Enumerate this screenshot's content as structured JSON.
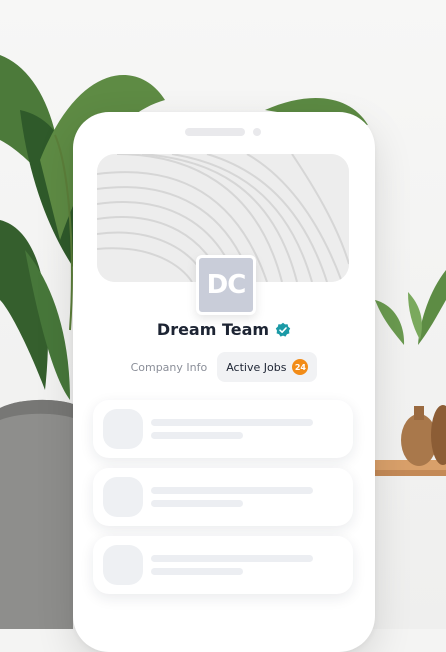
{
  "company": {
    "logo_initials": "DC",
    "name": "Dream Team",
    "verified_icon": "verified-badge-icon"
  },
  "tabs": [
    {
      "label": "Company Info",
      "active": false
    },
    {
      "label": "Active Jobs",
      "active": true,
      "badge": "24"
    }
  ],
  "placeholder_cards": 3,
  "colors": {
    "badge": "#f28c18",
    "verified": "#1b9aa6",
    "logo_bg": "#c9cdd9"
  }
}
